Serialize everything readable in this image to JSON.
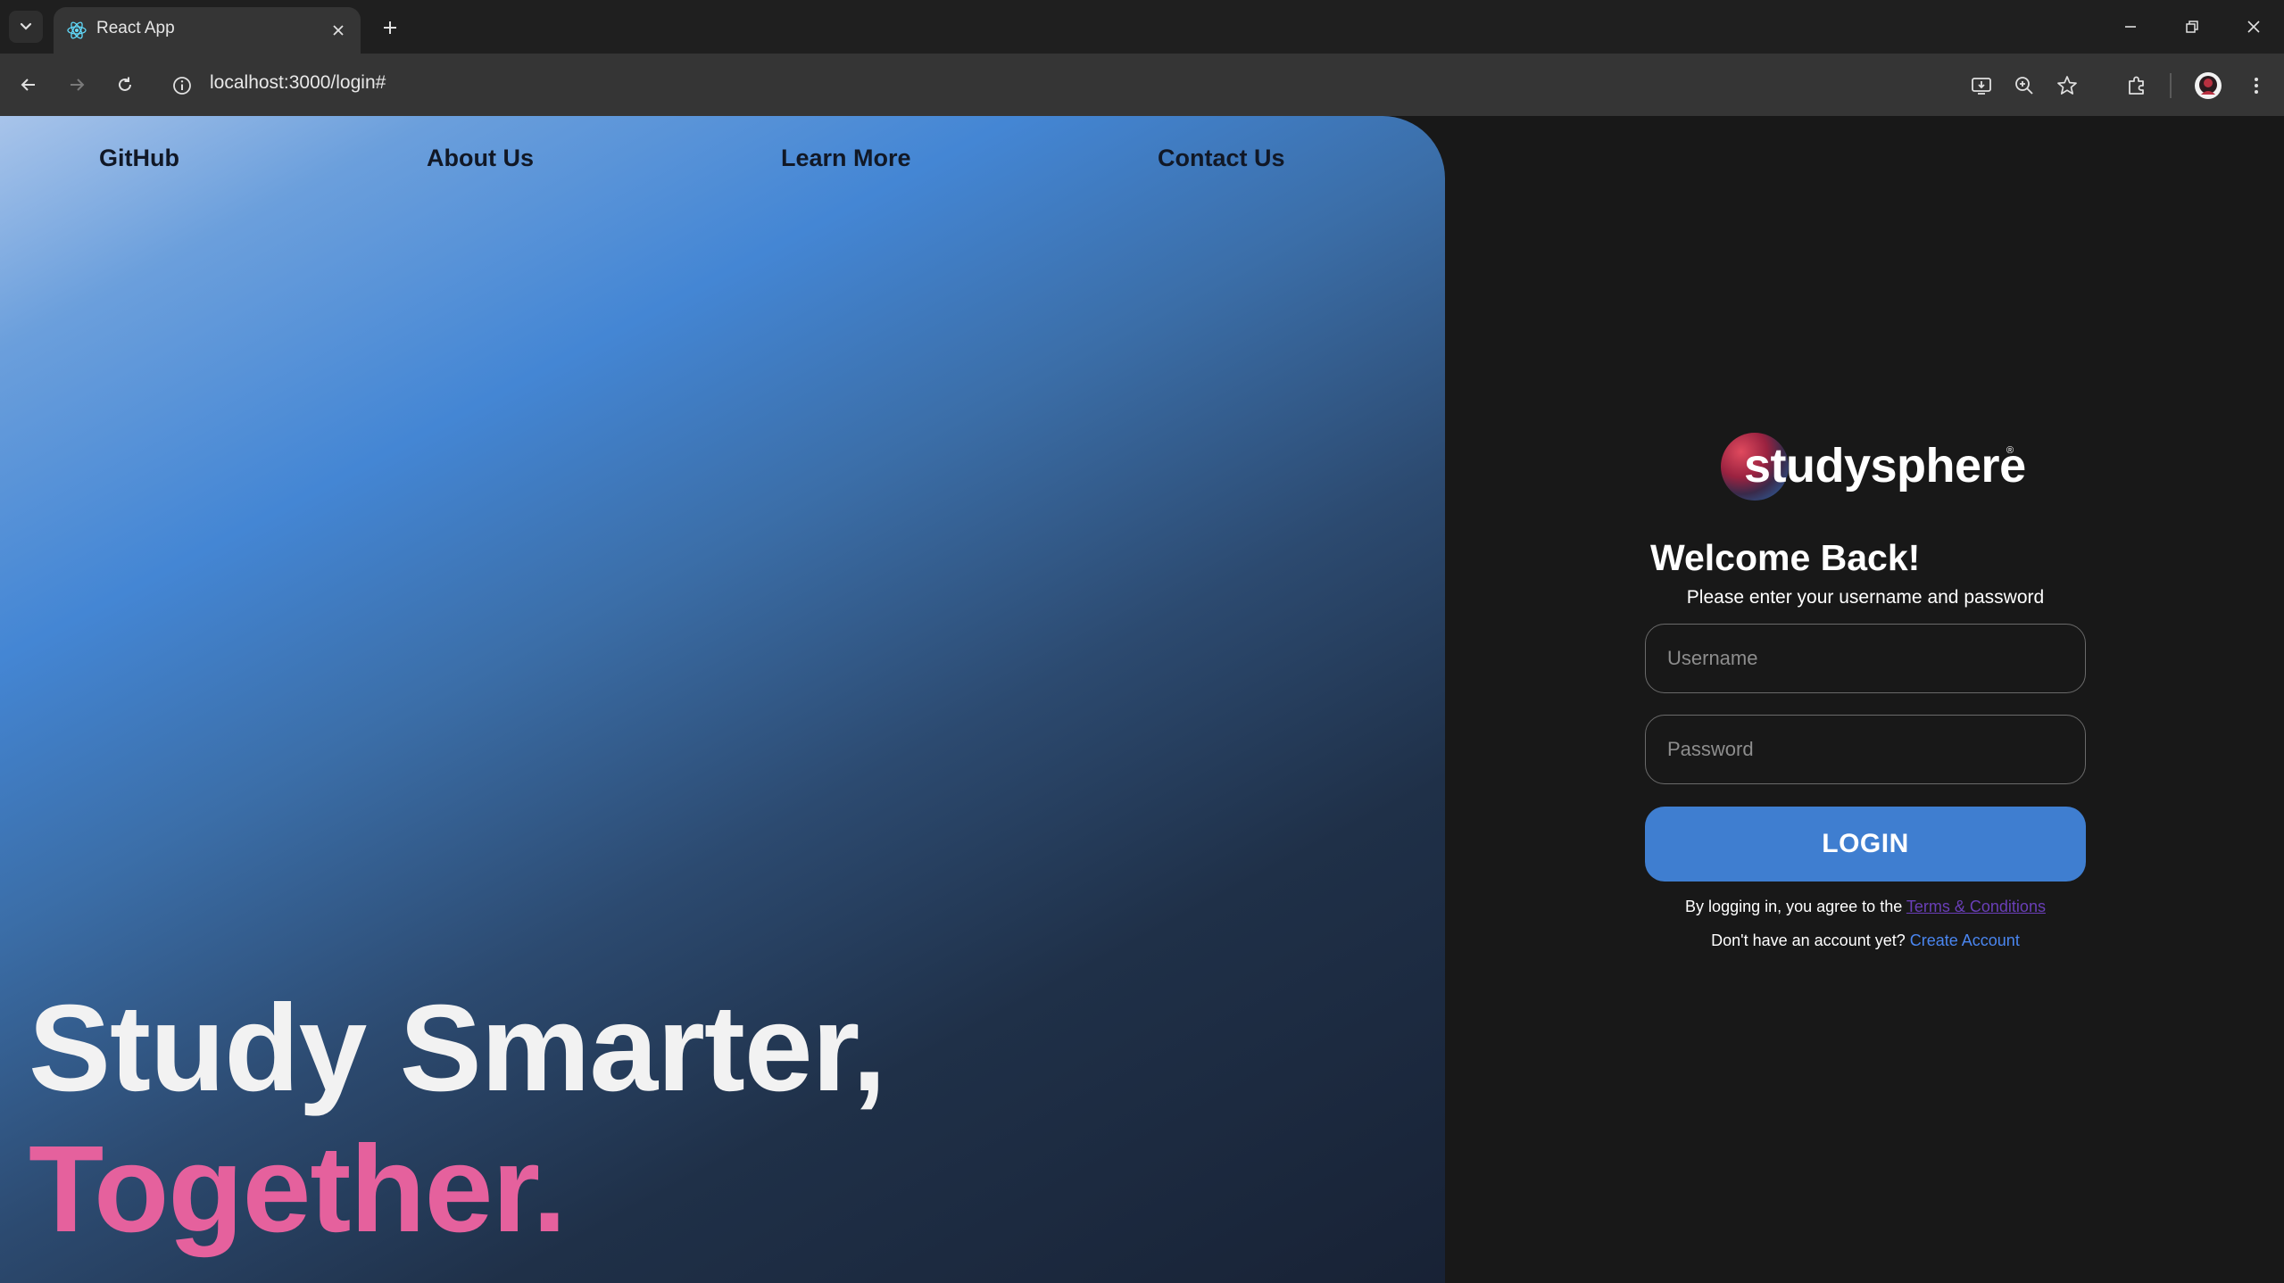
{
  "browser": {
    "tab_title": "React App",
    "url": "localhost:3000/login#"
  },
  "nav": {
    "github": "GitHub",
    "about": "About Us",
    "learn": "Learn More",
    "contact": "Contact Us"
  },
  "hero": {
    "line1": "Study Smarter,",
    "line2": "Together."
  },
  "login": {
    "logo_text": "studysphere",
    "logo_mark": "®",
    "title": "Welcome Back!",
    "subtitle": "Please enter your username and password",
    "username_placeholder": "Username",
    "password_placeholder": "Password",
    "button_label": "LOGIN",
    "terms_prefix": "By logging in, you agree to the ",
    "terms_link": "Terms & Conditions",
    "create_prefix": "Don't have an account yet? ",
    "create_link": "Create Account"
  },
  "colors": {
    "accent_blue": "#3f7ed0",
    "headline_pink": "#e5619d",
    "terms_purple": "#6a3fb8",
    "link_blue": "#4a86f0"
  }
}
